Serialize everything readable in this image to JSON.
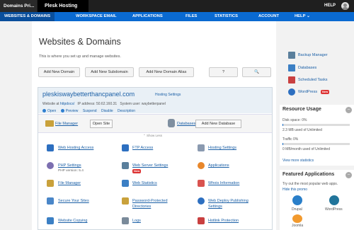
{
  "topbar": {
    "tab1": "Domains Pri...",
    "tab2": "Plesk Hosting",
    "help": "HELP"
  },
  "nav": [
    "WEBSITES & DOMAINS",
    "WORKSPACE EMAIL",
    "APPLICATIONS",
    "FILES",
    "STATISTICS",
    "ACCOUNT",
    "HELP"
  ],
  "page": {
    "title": "Websites & Domains",
    "description": "This is where you set up and manage websites."
  },
  "toolbar": {
    "add_domain": "Add New Domain",
    "add_subdomain": "Add New Subdomain",
    "add_alias": "Add New Domain Alias",
    "btn_help": "?",
    "btn_search": "🔍"
  },
  "domain": {
    "name": "pleskiswaybetterthancpanel.com",
    "hosting_settings": "Hosting Settings",
    "website_at": "Website at",
    "httpdocs": "httpdocs/",
    "ip_label": "IP address: 50.62.160.31",
    "system_user": "System user: waybetterpanel",
    "actions": [
      "Open",
      "Preview",
      "Suspend",
      "Disable",
      "Description"
    ]
  },
  "tools": {
    "file_manager": "File Manager",
    "open_site": "Open Site",
    "databases": "Databases",
    "add_database": "Add New Database",
    "show_less": "⌃ Show Less"
  },
  "grid": {
    "web_hosting_access": "Web Hosting Access",
    "ftp_access": "FTP Access",
    "hosting_settings": "Hosting Settings",
    "php_settings": "PHP Settings",
    "php_version": "PHP version: 5.4",
    "web_server_settings": "Web Server Settings",
    "applications": "Applications",
    "file_manager": "File Manager",
    "web_statistics": "Web Statistics",
    "whois_information": "Whois Information",
    "secure_your_sites": "Secure Your Sites",
    "password_protected_1": "Password-Protected",
    "password_protected_2": "Directories",
    "web_deploy_1": "Web Deploy Publishing",
    "web_deploy_2": "Settings",
    "website_copying": "Website Copying",
    "logs": "Logs",
    "hotlink_protection": "Hotlink Protection",
    "new_badge": "New"
  },
  "sidebar": {
    "links": [
      "Backup Manager",
      "Databases",
      "Scheduled Tasks",
      "WordPress"
    ],
    "new_badge": "New"
  },
  "resource_usage": {
    "title": "Resource Usage",
    "disk_label": "Disk space: 0%",
    "disk_detail": "2.3 MB used of Unlimited",
    "disk_fraction": 0.0,
    "traffic_label": "Traffic 0%",
    "traffic_detail": "0 MB/month used of Unlimited",
    "traffic_fraction": 0.0,
    "view_more": "View more statistics"
  },
  "featured_apps": {
    "title": "Featured Applications",
    "description": "Try out the most popular web apps.",
    "hide": "Hide this promo",
    "apps": [
      "Drupal",
      "WordPress",
      "Joomla"
    ]
  },
  "colors": {
    "nav_blue": "#0a6ad1",
    "nav_active": "#0a4f9c",
    "link_blue": "#1a5fa6",
    "topbar": "#1f1f1f",
    "badge_red": "#d33"
  }
}
